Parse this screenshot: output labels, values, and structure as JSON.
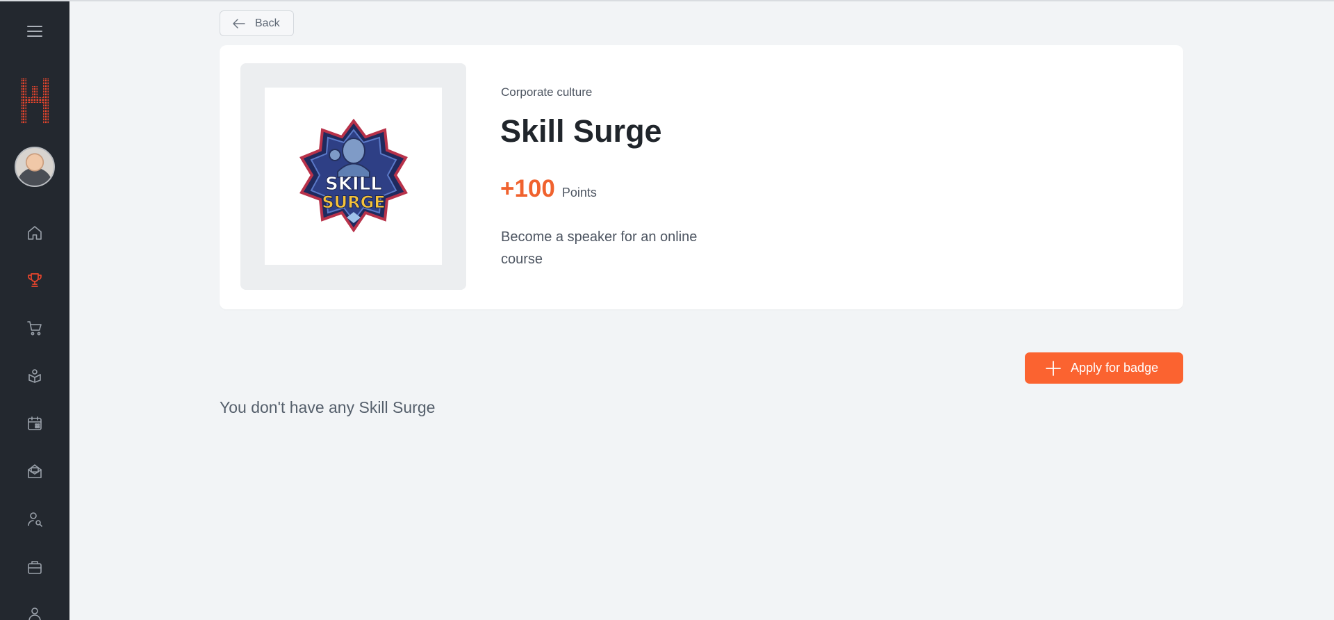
{
  "sidebar": {
    "icons": [
      "menu-icon",
      "logo",
      "avatar",
      "home-icon",
      "trophy-icon",
      "cart-icon",
      "graduation-icon",
      "calendar-icon",
      "inbox-icon",
      "user-search-icon",
      "briefcase-icon",
      "user-icon"
    ],
    "active_color": "#e8452c"
  },
  "back_button": {
    "label": "Back"
  },
  "badge": {
    "category": "Corporate culture",
    "title": "Skill Surge",
    "points_value": "+100",
    "points_label": "Points",
    "description": "Become a speaker for an online course",
    "logo_text_top": "SKILL",
    "logo_text_bottom": "SURGE"
  },
  "actions": {
    "apply_label": "Apply for badge"
  },
  "empty_state": {
    "message": "You don't have any Skill Surge"
  },
  "colors": {
    "accent": "#fb6330",
    "sidebar_bg": "#23282f",
    "page_bg": "#f2f4f6"
  }
}
